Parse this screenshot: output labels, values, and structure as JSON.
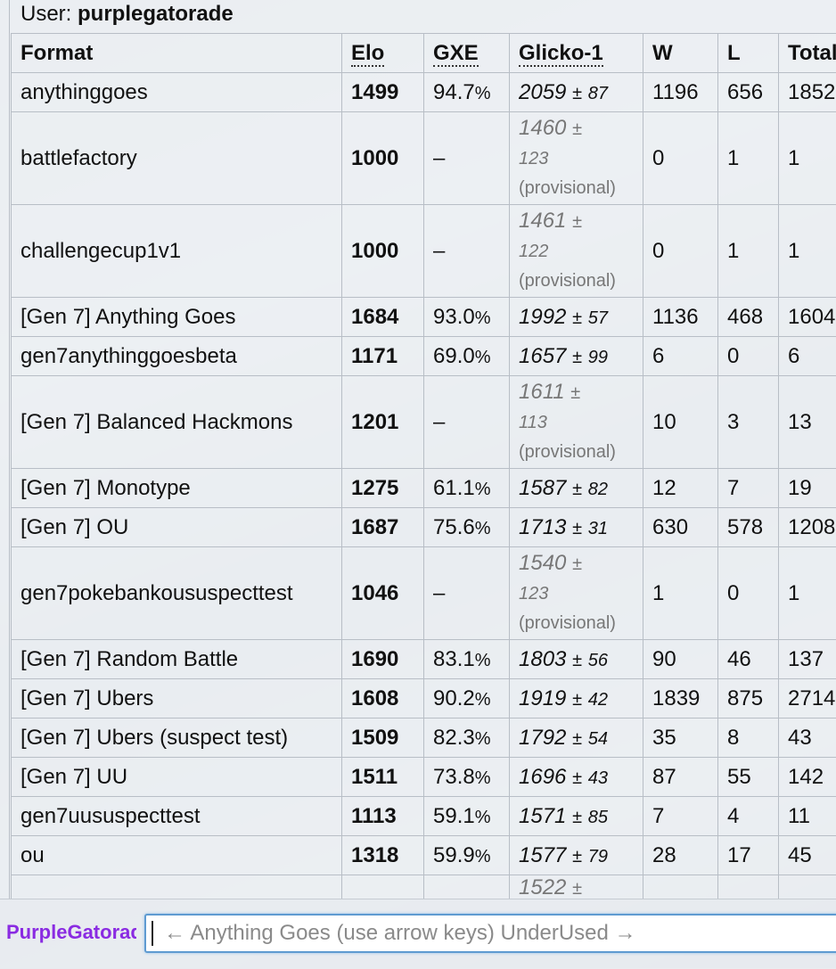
{
  "header": {
    "user_label": "User:",
    "username": "purplegatorade"
  },
  "table": {
    "columns": [
      "Format",
      "Elo",
      "GXE",
      "Glicko-1",
      "W",
      "L",
      "Total"
    ],
    "rows": [
      {
        "format": "anythinggoes",
        "elo": "1499",
        "gxe_main": "94.7",
        "gxe_pct": "%",
        "gl_val": "2059",
        "gl_pm": "±",
        "gl_dev": "87",
        "w": "1196",
        "l": "656",
        "total": "1852",
        "provisional": false
      },
      {
        "format": "battlefactory",
        "elo": "1000",
        "gxe_main": "–",
        "gxe_pct": "",
        "gl_val": "1460",
        "gl_pm": "±",
        "gl_dev": "123",
        "gl_note": "(provisional)",
        "w": "0",
        "l": "1",
        "total": "1",
        "provisional": true
      },
      {
        "format": "challengecup1v1",
        "elo": "1000",
        "gxe_main": "–",
        "gxe_pct": "",
        "gl_val": "1461",
        "gl_pm": "±",
        "gl_dev": "122",
        "gl_note": "(provisional)",
        "w": "0",
        "l": "1",
        "total": "1",
        "provisional": true
      },
      {
        "format": "[Gen 7] Anything Goes",
        "elo": "1684",
        "gxe_main": "93.0",
        "gxe_pct": "%",
        "gl_val": "1992",
        "gl_pm": "±",
        "gl_dev": "57",
        "w": "1136",
        "l": "468",
        "total": "1604",
        "provisional": false
      },
      {
        "format": "gen7anythinggoesbeta",
        "elo": "1171",
        "gxe_main": "69.0",
        "gxe_pct": "%",
        "gl_val": "1657",
        "gl_pm": "±",
        "gl_dev": "99",
        "w": "6",
        "l": "0",
        "total": "6",
        "provisional": false
      },
      {
        "format": "[Gen 7] Balanced Hackmons",
        "elo": "1201",
        "gxe_main": "–",
        "gxe_pct": "",
        "gl_val": "1611",
        "gl_pm": "±",
        "gl_dev": "113",
        "gl_note": "(provisional)",
        "w": "10",
        "l": "3",
        "total": "13",
        "provisional": true
      },
      {
        "format": "[Gen 7] Monotype",
        "elo": "1275",
        "gxe_main": "61.1",
        "gxe_pct": "%",
        "gl_val": "1587",
        "gl_pm": "±",
        "gl_dev": "82",
        "w": "12",
        "l": "7",
        "total": "19",
        "provisional": false
      },
      {
        "format": "[Gen 7] OU",
        "elo": "1687",
        "gxe_main": "75.6",
        "gxe_pct": "%",
        "gl_val": "1713",
        "gl_pm": "±",
        "gl_dev": "31",
        "w": "630",
        "l": "578",
        "total": "1208",
        "provisional": false
      },
      {
        "format": "gen7pokebankoususpecttest",
        "elo": "1046",
        "gxe_main": "–",
        "gxe_pct": "",
        "gl_val": "1540",
        "gl_pm": "±",
        "gl_dev": "123",
        "gl_note": "(provisional)",
        "w": "1",
        "l": "0",
        "total": "1",
        "provisional": true
      },
      {
        "format": "[Gen 7] Random Battle",
        "elo": "1690",
        "gxe_main": "83.1",
        "gxe_pct": "%",
        "gl_val": "1803",
        "gl_pm": "±",
        "gl_dev": "56",
        "w": "90",
        "l": "46",
        "total": "137",
        "provisional": false
      },
      {
        "format": "[Gen 7] Ubers",
        "elo": "1608",
        "gxe_main": "90.2",
        "gxe_pct": "%",
        "gl_val": "1919",
        "gl_pm": "±",
        "gl_dev": "42",
        "w": "1839",
        "l": "875",
        "total": "2714",
        "provisional": false
      },
      {
        "format": "[Gen 7] Ubers (suspect test)",
        "elo": "1509",
        "gxe_main": "82.3",
        "gxe_pct": "%",
        "gl_val": "1792",
        "gl_pm": "±",
        "gl_dev": "54",
        "w": "35",
        "l": "8",
        "total": "43",
        "provisional": false
      },
      {
        "format": "[Gen 7] UU",
        "elo": "1511",
        "gxe_main": "73.8",
        "gxe_pct": "%",
        "gl_val": "1696",
        "gl_pm": "±",
        "gl_dev": "43",
        "w": "87",
        "l": "55",
        "total": "142",
        "provisional": false
      },
      {
        "format": "gen7uususpecttest",
        "elo": "1113",
        "gxe_main": "59.1",
        "gxe_pct": "%",
        "gl_val": "1571",
        "gl_pm": "±",
        "gl_dev": "85",
        "w": "7",
        "l": "4",
        "total": "11",
        "provisional": false
      },
      {
        "format": "ou",
        "elo": "1318",
        "gxe_main": "59.9",
        "gxe_pct": "%",
        "gl_val": "1577",
        "gl_pm": "±",
        "gl_dev": "79",
        "w": "28",
        "l": "17",
        "total": "45",
        "provisional": false
      }
    ],
    "partial_row": {
      "gl_val": "1522",
      "gl_pm": "±"
    }
  },
  "chat": {
    "username": "PurpleGatorade",
    "input_value": "← Anything Goes (use arrow keys) UnderUsed →"
  },
  "colors": {
    "username": "#8a2be2",
    "input_border": "#5f9bd1",
    "provisional_text": "#777777"
  }
}
